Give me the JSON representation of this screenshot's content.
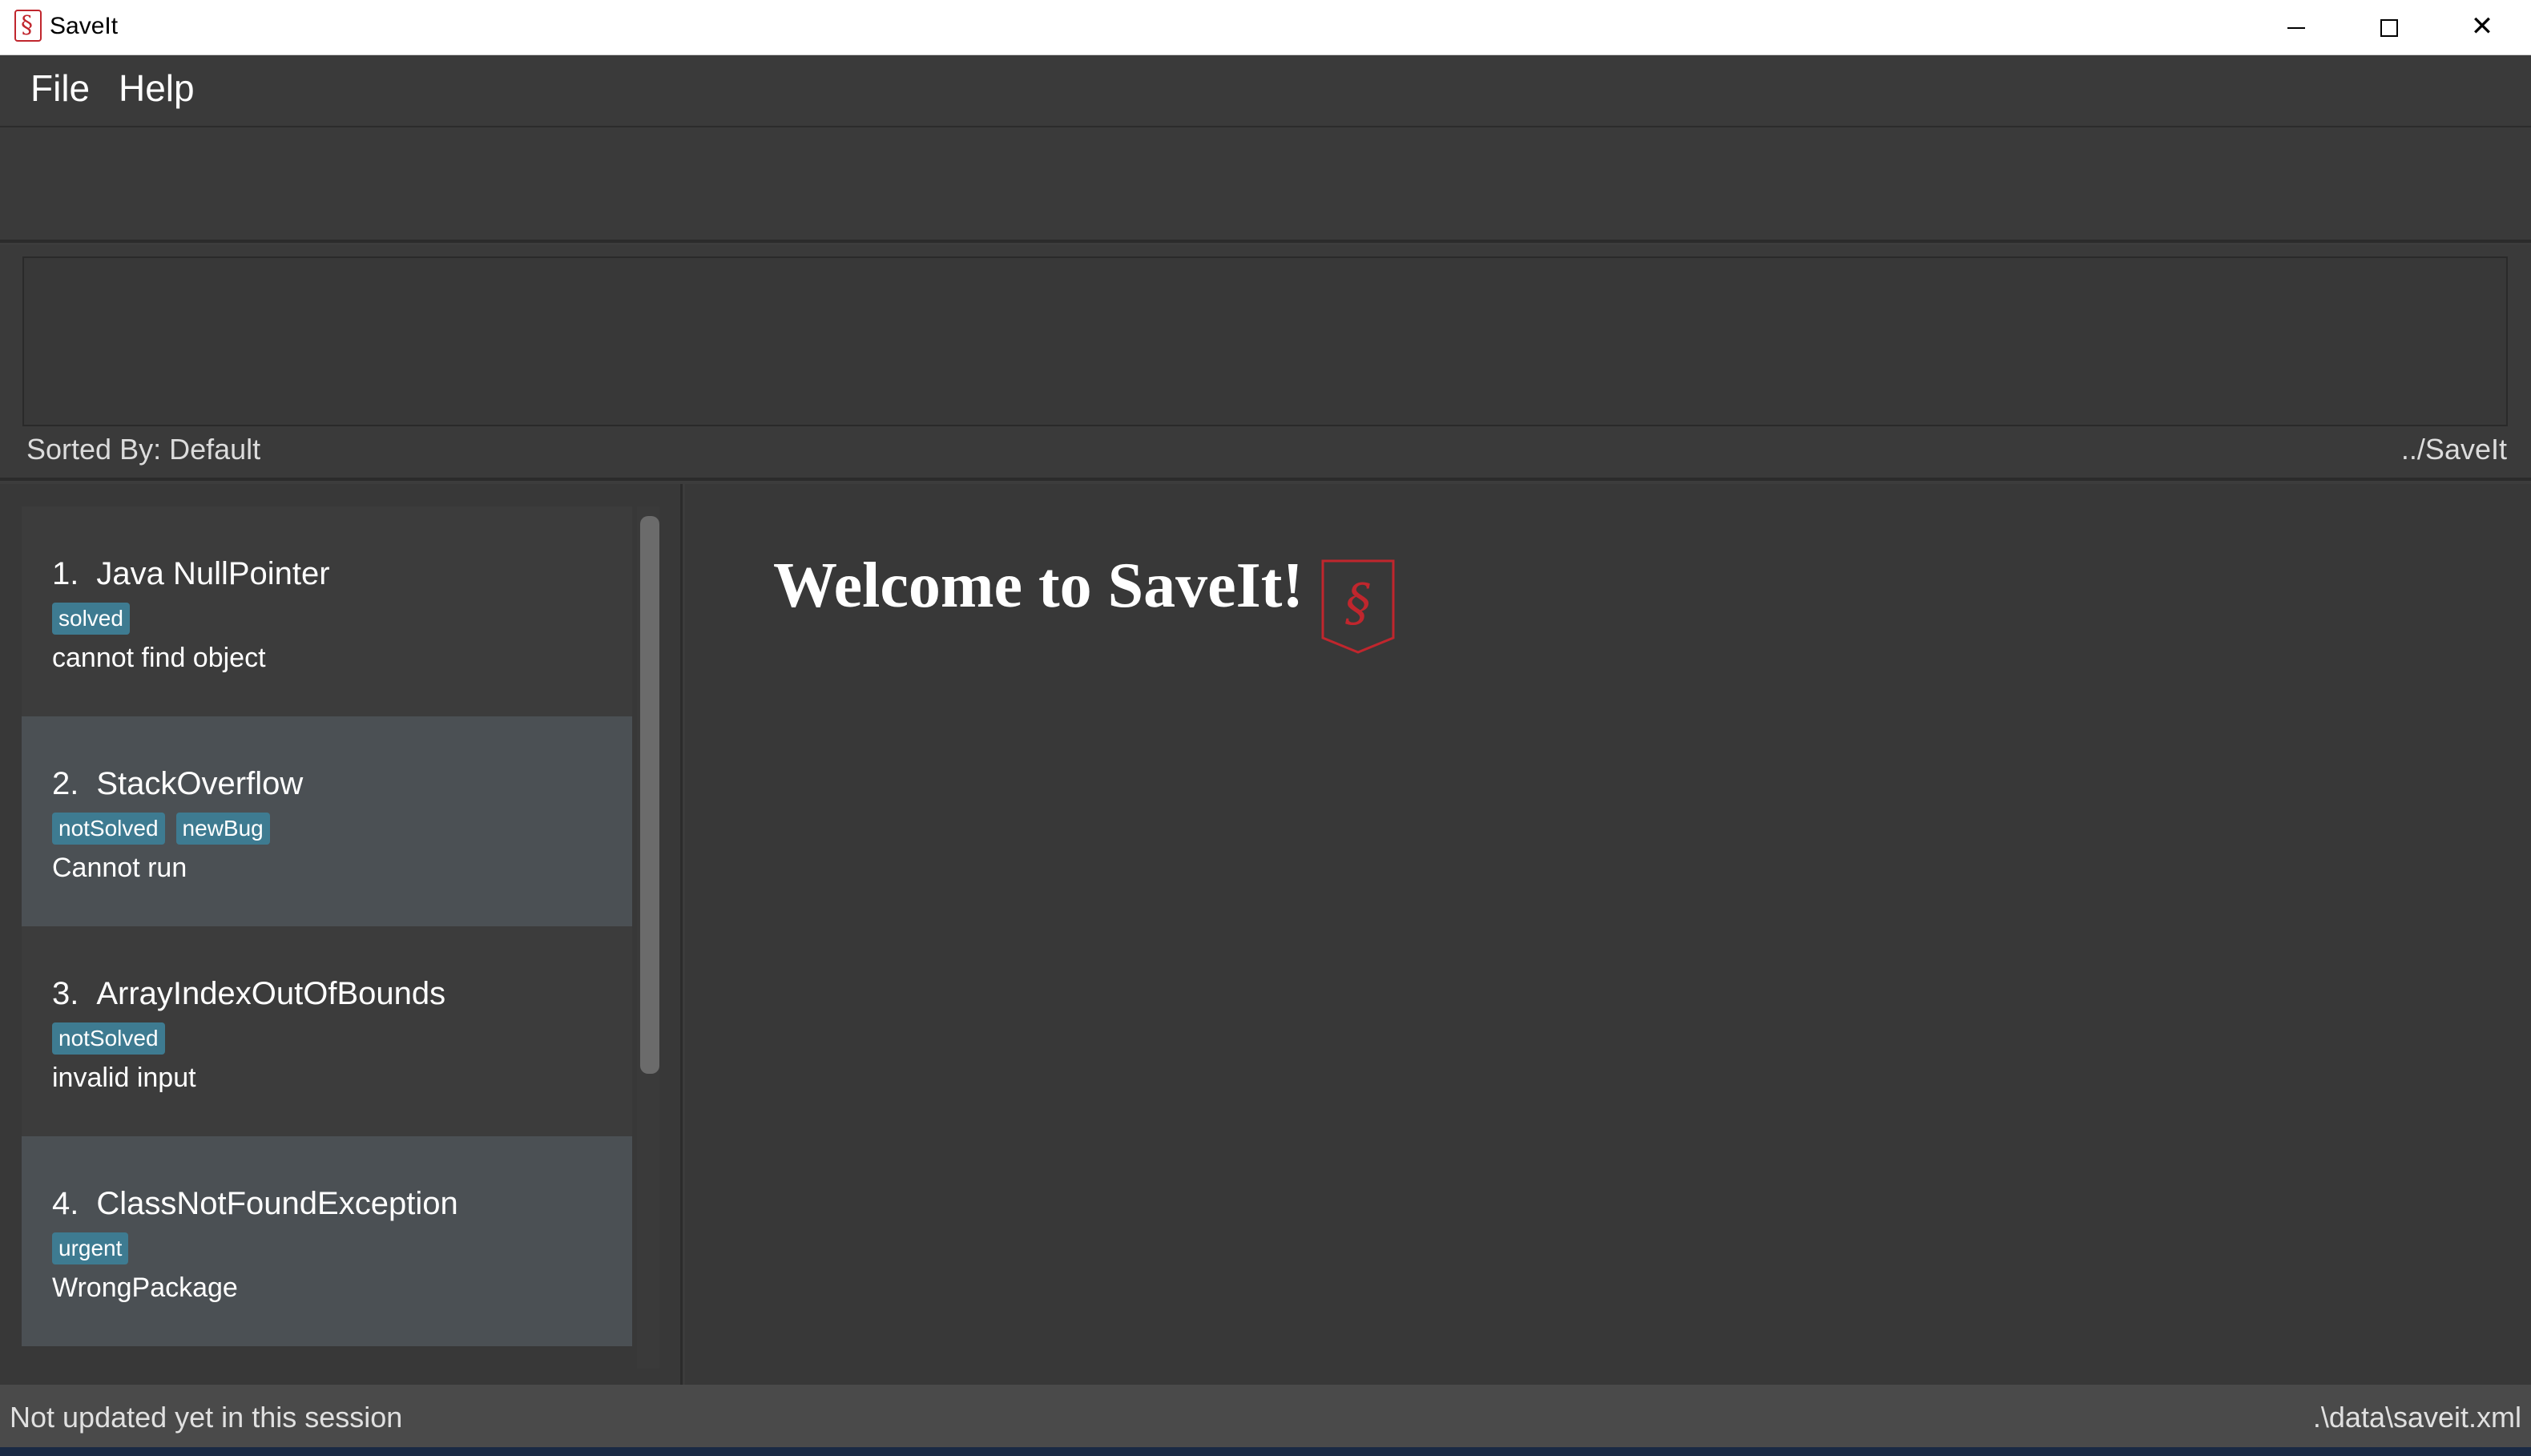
{
  "window": {
    "title": "SaveIt",
    "controls": {
      "minimize": "minimize-icon",
      "maximize": "maximize-icon",
      "close": "close-icon"
    }
  },
  "menu": {
    "items": [
      {
        "label": "File"
      },
      {
        "label": "Help"
      }
    ]
  },
  "command": {
    "value": ""
  },
  "result": {
    "text": "",
    "sorted_by": "Sorted By: Default",
    "path": "../SaveIt"
  },
  "issues": [
    {
      "index": "1.",
      "title": "Java NullPointer",
      "tags": [
        "solved"
      ],
      "description": "cannot find object"
    },
    {
      "index": "2.",
      "title": "StackOverflow",
      "tags": [
        "notSolved",
        "newBug"
      ],
      "description": "Cannot run"
    },
    {
      "index": "3.",
      "title": "ArrayIndexOutOfBounds",
      "tags": [
        "notSolved"
      ],
      "description": "invalid input"
    },
    {
      "index": "4.",
      "title": "ClassNotFoundException",
      "tags": [
        "urgent"
      ],
      "description": "WrongPackage"
    }
  ],
  "detail": {
    "welcome": "Welcome to SaveIt!",
    "logo_icon": "saveit-logo-icon"
  },
  "status": {
    "sync": "Not updated yet in this session",
    "file": ".\\data\\saveit.xml"
  },
  "colors": {
    "background": "#383838",
    "tag": "#3e7b91",
    "selected_card": "#4b5054",
    "logo": "#c0262d"
  }
}
